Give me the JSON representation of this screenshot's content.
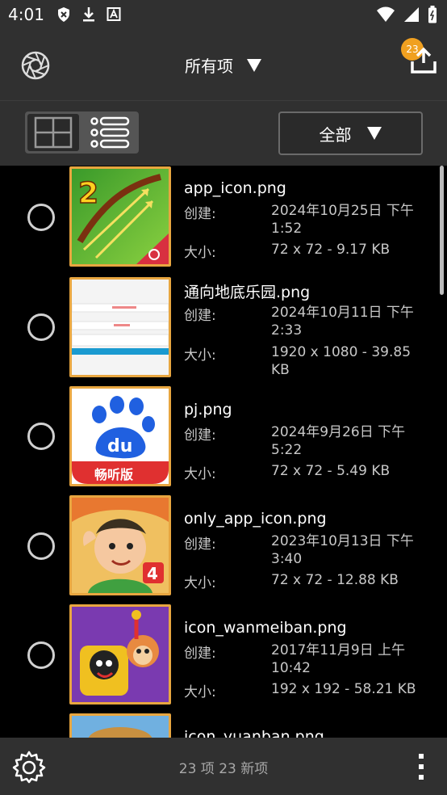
{
  "status_bar": {
    "time": "4:01"
  },
  "app_bar": {
    "title": "所有项",
    "badge_count": "23"
  },
  "toolbar": {
    "filter_label": "全部"
  },
  "files": [
    {
      "name": "app_icon.png",
      "created_label": "创建:",
      "created_value": "2024年10月25日 下午1:52",
      "size_label": "大小:",
      "size_value": "72 x 72 - 9.17 KB"
    },
    {
      "name": "通向地底乐园.png",
      "created_label": "创建:",
      "created_value": "2024年10月11日 下午2:33",
      "size_label": "大小:",
      "size_value": "1920 x 1080 - 39.85 KB"
    },
    {
      "name": "pj.png",
      "created_label": "创建:",
      "created_value": "2024年9月26日 下午5:22",
      "size_label": "大小:",
      "size_value": "72 x 72 - 5.49 KB"
    },
    {
      "name": "only_app_icon.png",
      "created_label": "创建:",
      "created_value": "2023年10月13日 下午3:40",
      "size_label": "大小:",
      "size_value": "72 x 72 - 12.88 KB"
    },
    {
      "name": "icon_wanmeiban.png",
      "created_label": "创建:",
      "created_value": "2017年11月9日 上午10:42",
      "size_label": "大小:",
      "size_value": "192 x 192 - 58.21 KB"
    },
    {
      "name": "icon_yuanban.png"
    }
  ],
  "bottom_bar": {
    "count_text": "23 项  23 新项"
  },
  "icons": {
    "status": [
      "shield-icon",
      "download-icon",
      "a-box-icon",
      "wifi-icon",
      "signal-icon",
      "battery-icon"
    ],
    "app_bar": [
      "aperture-icon",
      "dropdown-triangle-icon",
      "upload-icon"
    ],
    "toolbar": [
      "grid-view-icon",
      "list-view-icon",
      "dropdown-triangle-icon"
    ],
    "bottom": [
      "gear-icon",
      "more-vertical-icon"
    ]
  },
  "colors": {
    "bar_bg": "#303030",
    "thumb_border": "#e8a640",
    "badge": "#f0a020",
    "list_bg": "#000000"
  }
}
